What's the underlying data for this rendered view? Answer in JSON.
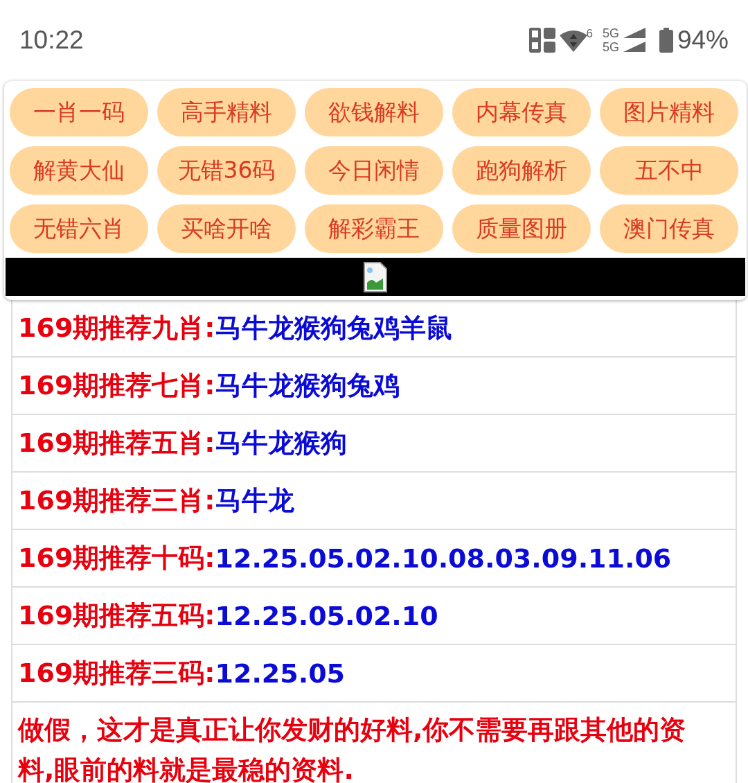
{
  "status_bar": {
    "time": "10:22",
    "wifi_badge": "6",
    "network_top": "5G",
    "network_bottom": "5G",
    "battery": "94%"
  },
  "menu_buttons": [
    {
      "label": "一肖一码"
    },
    {
      "label": "高手精料"
    },
    {
      "label": "欲钱解料"
    },
    {
      "label": "内幕传真"
    },
    {
      "label": "图片精料"
    },
    {
      "label": "解黄大仙"
    },
    {
      "label": "无错36码"
    },
    {
      "label": "今日闲情"
    },
    {
      "label": "跑狗解析"
    },
    {
      "label": "五不中"
    },
    {
      "label": "无错六肖"
    },
    {
      "label": "买啥开啥"
    },
    {
      "label": "解彩霸王"
    },
    {
      "label": "质量图册"
    },
    {
      "label": "澳门传真"
    }
  ],
  "banner": {
    "kind": "broken-image"
  },
  "rows": [
    {
      "kind": "pick",
      "label": "169期推荐九肖:",
      "value": "马牛龙猴狗兔鸡羊鼠"
    },
    {
      "kind": "pick",
      "label": "169期推荐七肖:",
      "value": "马牛龙猴狗兔鸡"
    },
    {
      "kind": "pick",
      "label": "169期推荐五肖:",
      "value": "马牛龙猴狗"
    },
    {
      "kind": "pick",
      "label": "169期推荐三肖:",
      "value": "马牛龙"
    },
    {
      "kind": "pick",
      "label": "169期推荐十码:",
      "value": "12.25.05.02.10.08.03.09.11.06"
    },
    {
      "kind": "pick",
      "label": "169期推荐五码:",
      "value": "12.25.05.02.10"
    },
    {
      "kind": "pick",
      "label": "169期推荐三码:",
      "value": "12.25.05"
    },
    {
      "kind": "note",
      "text": "做假，这才是真正让你发财的好料,你不需要再跟其他的资料,眼前的料就是最稳的资料."
    }
  ]
}
